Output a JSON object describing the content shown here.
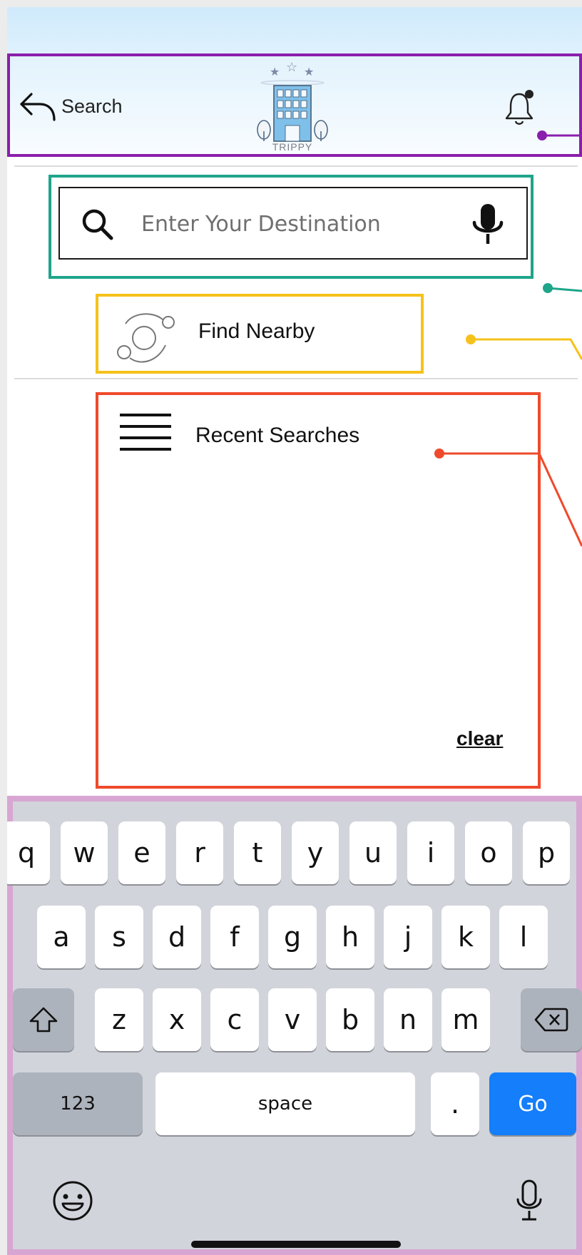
{
  "header": {
    "back_label": "Search",
    "logo_text": "TRIPPY"
  },
  "search": {
    "placeholder": "Enter Your Destination",
    "value": ""
  },
  "find_nearby": {
    "label": "Find Nearby"
  },
  "recent_searches": {
    "title": "Recent Searches",
    "clear_label": "clear"
  },
  "keyboard": {
    "row1": [
      "q",
      "w",
      "e",
      "r",
      "t",
      "y",
      "u",
      "i",
      "o",
      "p"
    ],
    "row2": [
      "a",
      "s",
      "d",
      "f",
      "g",
      "h",
      "j",
      "k",
      "l"
    ],
    "row3": [
      "z",
      "x",
      "c",
      "v",
      "b",
      "n",
      "m"
    ],
    "numbers_label": "123",
    "space_label": "space",
    "period_label": ".",
    "go_label": "Go"
  },
  "icons": {
    "back": "back-arrow-icon",
    "logo": "hotel-logo-icon",
    "bell": "notification-bell-icon",
    "search": "search-icon",
    "mic": "microphone-icon",
    "nearby": "orbit-nearby-icon",
    "menu": "hamburger-icon",
    "shift": "shift-icon",
    "backspace": "backspace-icon",
    "emoji": "emoji-icon",
    "dictation": "dictation-mic-icon"
  },
  "colors": {
    "annotation_purple": "#8a1fab",
    "annotation_teal": "#1ea58a",
    "annotation_yellow": "#f5c21b",
    "annotation_orange": "#ef4a2b",
    "annotation_pink": "#d8a6d2",
    "go_key": "#147efb",
    "header_top": "#cfeafc"
  }
}
